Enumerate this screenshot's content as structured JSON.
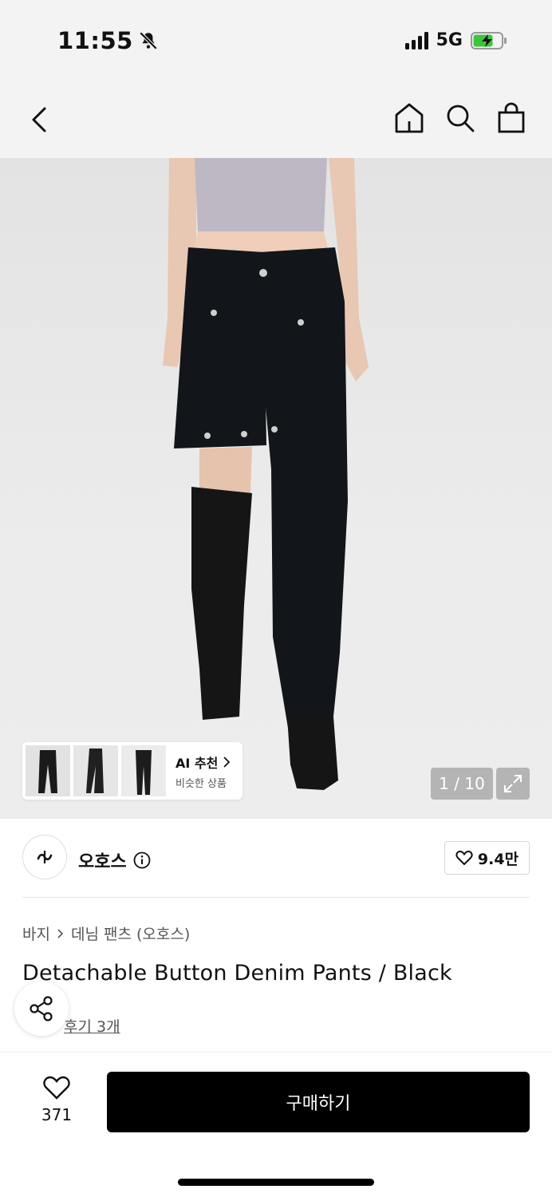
{
  "status_bar": {
    "time": "11:55",
    "network": "5G",
    "icons": [
      "bell-slash-icon",
      "signal-icon",
      "battery-charging-icon"
    ]
  },
  "nav": {
    "icons": [
      "back-chevron-icon",
      "home-icon",
      "search-icon",
      "shopping-bag-icon"
    ]
  },
  "gallery": {
    "counter": "1 / 10",
    "ai": {
      "title": "AI 추천",
      "subtitle": "비슷한 상품"
    }
  },
  "brand": {
    "name": "오호스",
    "likes": "9.4만"
  },
  "breadcrumb": {
    "category": "바지",
    "sub_category": "데님 팬츠 (오호스)"
  },
  "product": {
    "title": "Detachable Button Denim Pants / Black",
    "reviews": "후기 3개"
  },
  "bottom": {
    "wish_count": "371",
    "buy_label": "구매하기"
  },
  "colors": {
    "top_background": "#f3f3f3",
    "buy_button": "#000000",
    "denim": "#121519"
  }
}
